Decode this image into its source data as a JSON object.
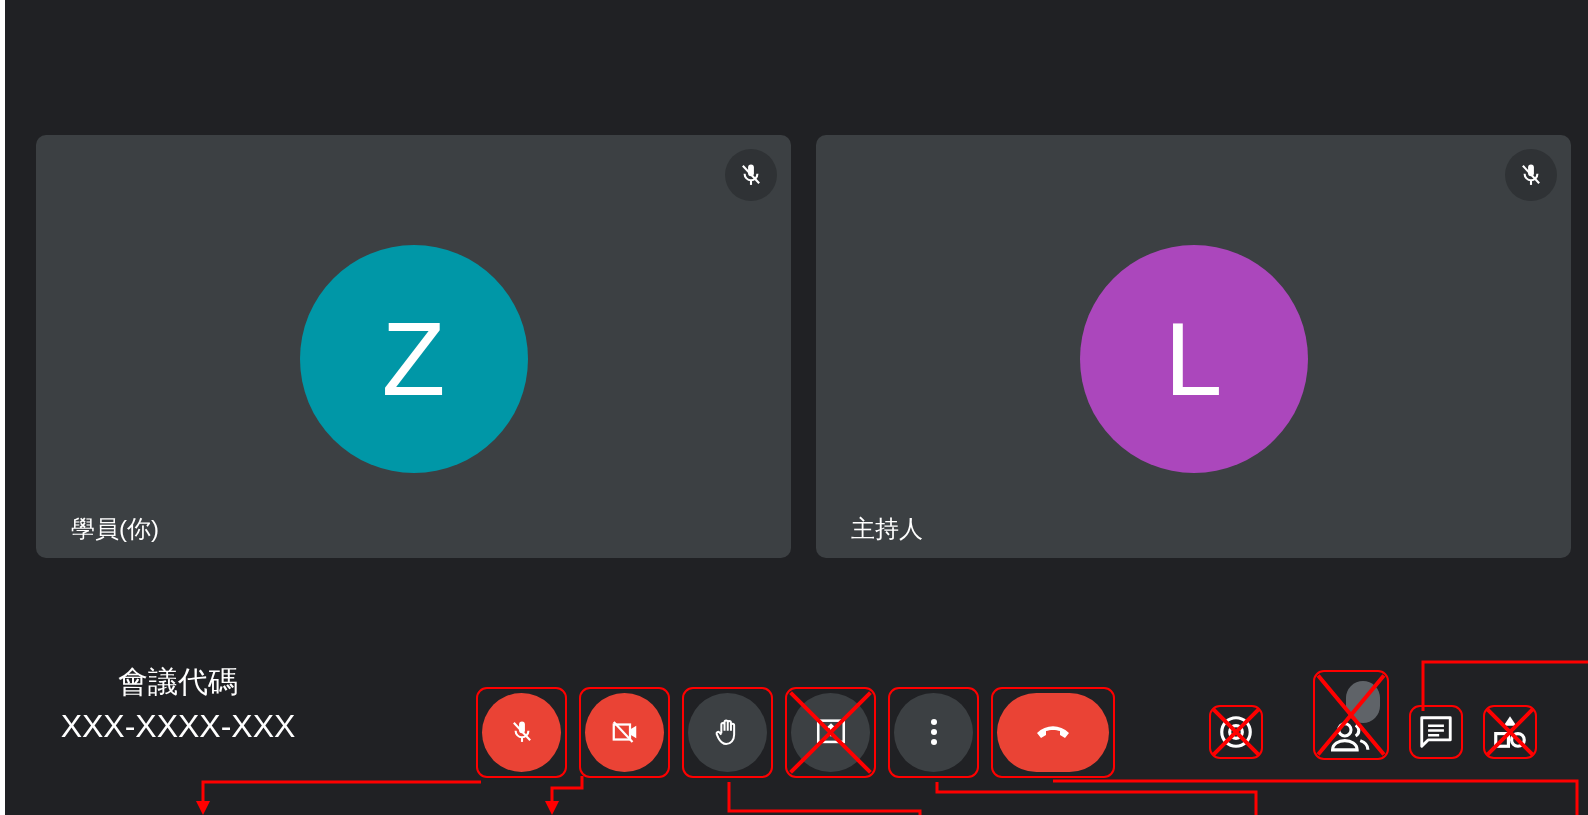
{
  "participants": [
    {
      "name": "學員(你)",
      "initial": "Z",
      "color": "#0097a7",
      "muted": true
    },
    {
      "name": "主持人",
      "initial": "L",
      "color": "#ab47bc",
      "muted": true
    }
  ],
  "meeting_code": {
    "label": "會議代碼",
    "code": "XXX-XXXX-XXX"
  },
  "controls": [
    {
      "kind": "mic",
      "off": true,
      "boxed": true,
      "crossed": false
    },
    {
      "kind": "camera",
      "off": true,
      "boxed": true,
      "crossed": false
    },
    {
      "kind": "hand",
      "boxed": true,
      "crossed": false
    },
    {
      "kind": "present",
      "boxed": true,
      "crossed": true
    },
    {
      "kind": "more",
      "boxed": true,
      "crossed": false
    },
    {
      "kind": "hangup",
      "boxed": true,
      "crossed": false
    }
  ],
  "side_controls": [
    {
      "kind": "info",
      "boxed": true,
      "crossed": true
    },
    {
      "kind": "people",
      "badge": true,
      "boxed": true,
      "crossed": true
    },
    {
      "kind": "chat",
      "boxed": true,
      "crossed": false
    },
    {
      "kind": "activities",
      "boxed": true,
      "crossed": true
    }
  ]
}
